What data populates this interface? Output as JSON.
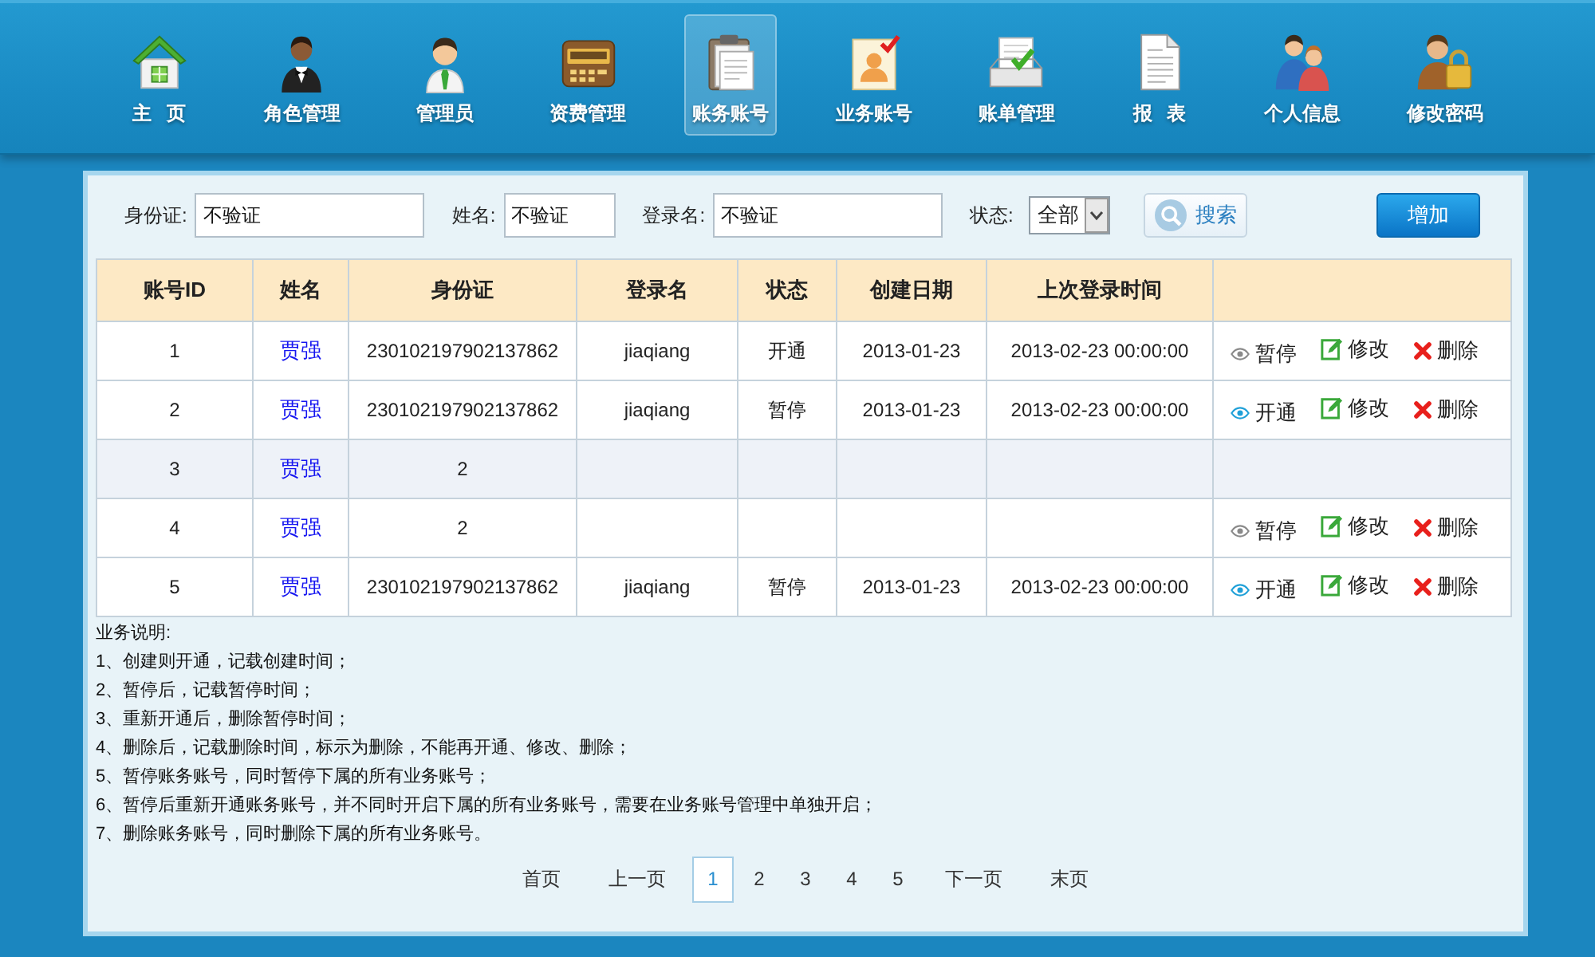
{
  "nav": [
    {
      "label": "主 页",
      "selected": false
    },
    {
      "label": "角色管理",
      "selected": false
    },
    {
      "label": "管理员",
      "selected": false
    },
    {
      "label": "资费管理",
      "selected": false
    },
    {
      "label": "账务账号",
      "selected": true
    },
    {
      "label": "业务账号",
      "selected": false
    },
    {
      "label": "账单管理",
      "selected": false
    },
    {
      "label": "报 表",
      "selected": false
    },
    {
      "label": "个人信息",
      "selected": false
    },
    {
      "label": "修改密码",
      "selected": false
    }
  ],
  "search": {
    "fields": [
      {
        "label": "身份证:",
        "value": "不验证"
      },
      {
        "label": "姓名:",
        "value": "不验证"
      },
      {
        "label": "登录名:",
        "value": "不验证"
      }
    ],
    "status": {
      "label": "状态:",
      "value": "全部"
    },
    "search_button": "搜索",
    "add_button": "增加"
  },
  "table": {
    "columns": [
      "账号ID",
      "姓名",
      "身份证",
      "登录名",
      "状态",
      "创建日期",
      "上次登录时间"
    ],
    "rows": [
      {
        "selected": false,
        "id": "1",
        "name": "贾强",
        "id_card": "230102197902137862",
        "login": "jiaqiang",
        "status": "开通",
        "created": "2013-01-23",
        "last_login": "2013-02-23 00:00:00",
        "actions": [
          {
            "kind": "pause",
            "label": "暂停"
          },
          {
            "kind": "edit",
            "label": "修改"
          },
          {
            "kind": "delete",
            "label": "删除"
          }
        ]
      },
      {
        "selected": false,
        "id": "2",
        "name": "贾强",
        "id_card": "230102197902137862",
        "login": "jiaqiang",
        "status": "暂停",
        "created": "2013-01-23",
        "last_login": "2013-02-23 00:00:00",
        "actions": [
          {
            "kind": "resume",
            "label": "开通"
          },
          {
            "kind": "edit",
            "label": "修改"
          },
          {
            "kind": "delete",
            "label": "删除"
          }
        ]
      },
      {
        "selected": true,
        "id": "3",
        "name": "贾强",
        "id_card": "2"
      },
      {
        "selected": false,
        "id": "4",
        "name": "贾强",
        "id_card": "2",
        "actions": [
          {
            "kind": "pause",
            "label": "暂停"
          },
          {
            "kind": "edit",
            "label": "修改"
          },
          {
            "kind": "delete",
            "label": "删除"
          }
        ]
      },
      {
        "selected": false,
        "id": "5",
        "name": "贾强",
        "id_card": "230102197902137862",
        "login": "jiaqiang",
        "status": "暂停",
        "created": "2013-01-23",
        "last_login": "2013-02-23 00:00:00",
        "actions": [
          {
            "kind": "resume",
            "label": "开通"
          },
          {
            "kind": "edit",
            "label": "修改"
          },
          {
            "kind": "delete",
            "label": "删除"
          }
        ]
      }
    ]
  },
  "notes": {
    "title": "业务说明:",
    "lines": [
      "1、创建则开通，记载创建时间；",
      "2、暂停后，记载暂停时间；",
      "3、重新开通后，删除暂停时间；",
      "4、删除后，记载删除时间，标示为删除，不能再开通、修改、删除；",
      "5、暂停账务账号，同时暂停下属的所有业务账号；",
      "6、暂停后重新开通账务账号，并不同时开启下属的所有业务账号，需要在业务账号管理中单独开启；",
      "7、删除账务账号，同时删除下属的所有业务账号。"
    ]
  },
  "pagination": [
    {
      "label": "首页",
      "selected": false
    },
    {
      "label": "上一页",
      "selected": false
    },
    {
      "label": "1",
      "selected": true
    },
    {
      "label": "2",
      "selected": false
    },
    {
      "label": "3",
      "selected": false
    },
    {
      "label": "4",
      "selected": false
    },
    {
      "label": "5",
      "selected": false
    },
    {
      "label": "下一页",
      "selected": false
    },
    {
      "label": "末页",
      "selected": false
    }
  ]
}
